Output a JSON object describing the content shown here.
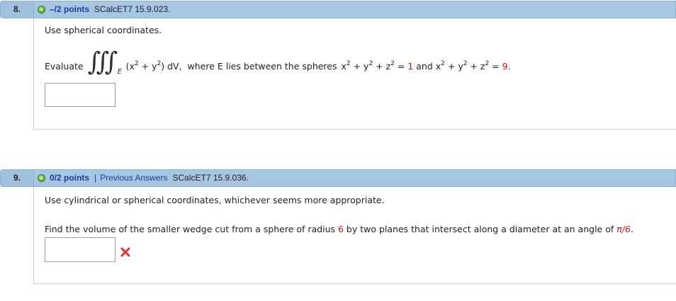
{
  "q8": {
    "number": "8.",
    "points": "–/2 points",
    "code": "SCalcET7 15.9.023.",
    "instruction": "Use spherical coordinates.",
    "evaluate_label": "Evaluate",
    "integral_symbol": "∫",
    "integral_region": "E",
    "integrand_open": "(x",
    "integrand_exp1": "2",
    "integrand_plus": " + y",
    "integrand_exp2": "2",
    "integrand_close": ") dV,",
    "where_text": "where E lies between the spheres",
    "sphere1_x": "x",
    "sphere1_y": " + y",
    "sphere1_z": " + z",
    "sphere1_eq": " = ",
    "sphere1_value": "1",
    "and_text": " and ",
    "sphere2_x": "x",
    "sphere2_y": " + y",
    "sphere2_z": " + z",
    "sphere2_eq": " = ",
    "sphere2_value": "9",
    "period": ".",
    "exp": "2",
    "answer_value": ""
  },
  "q9": {
    "number": "9.",
    "points": "0/2 points",
    "separator": "|",
    "previous_answers": "Previous Answers",
    "code": "SCalcET7 15.9.036.",
    "instruction": "Use cylindrical or spherical coordinates, whichever seems more appropriate.",
    "problem_pre": "Find the volume of the smaller wedge cut from a sphere of radius ",
    "radius": "6",
    "problem_mid": " by two planes that intersect along a diameter at an angle of ",
    "angle": "π/6",
    "period": ".",
    "answer_value": "",
    "status_icon": "incorrect-x-icon",
    "status_color": "#e03030"
  },
  "colors": {
    "header_bg": "#a7c6e2",
    "link": "#1a3d99",
    "highlight_red": "#cc1111"
  }
}
